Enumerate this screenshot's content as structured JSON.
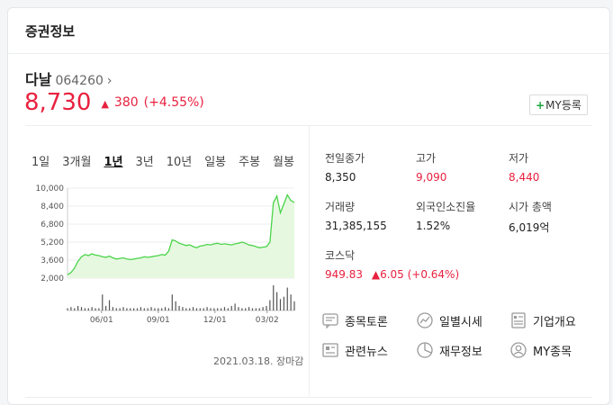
{
  "header": {
    "title": "증권정보"
  },
  "stock": {
    "name": "다날",
    "code": "064260",
    "price": "8,730",
    "change": "380",
    "change_pct": "(+4.55%)",
    "my_button": "MY등록"
  },
  "periods": [
    "1일",
    "3개월",
    "1년",
    "3년",
    "10년",
    "일봉",
    "주봉",
    "월봉"
  ],
  "active_period": "1년",
  "chart_data": {
    "type": "area",
    "y_ticks": [
      "10,000",
      "8,400",
      "6,800",
      "5,200",
      "3,600",
      "2,000"
    ],
    "x_ticks": [
      "06/01",
      "09/01",
      "12/01",
      "03/02"
    ],
    "ylim": [
      2000,
      10000
    ],
    "values": [
      2300,
      2500,
      2900,
      3500,
      3900,
      4100,
      4000,
      4150,
      4050,
      4000,
      3900,
      3850,
      3950,
      3800,
      3700,
      3750,
      3800,
      3700,
      3650,
      3700,
      3750,
      3800,
      3900,
      3850,
      3900,
      3950,
      4000,
      4100,
      4050,
      4400,
      5400,
      5300,
      5100,
      5000,
      4900,
      4950,
      4800,
      4700,
      4850,
      4900,
      5000,
      4950,
      5050,
      5100,
      5000,
      5050,
      5000,
      4950,
      5050,
      5100,
      5200,
      5100,
      4950,
      4900,
      4800,
      4700,
      4750,
      4800,
      5200,
      8700,
      9300,
      7800,
      8600,
      9400,
      8900,
      8730
    ],
    "volume": [
      2,
      3,
      2,
      4,
      3,
      2,
      2,
      3,
      2,
      2,
      14,
      4,
      9,
      3,
      2,
      2,
      3,
      2,
      2,
      2,
      2,
      3,
      2,
      2,
      3,
      2,
      2,
      2,
      3,
      2,
      14,
      8,
      4,
      3,
      2,
      2,
      3,
      2,
      2,
      2,
      3,
      2,
      2,
      2,
      2,
      3,
      2,
      4,
      6,
      3,
      2,
      2,
      3,
      2,
      2,
      2,
      3,
      4,
      9,
      22,
      16,
      10,
      12,
      20,
      14,
      8
    ]
  },
  "updated": "2021.03.18. 장마감",
  "stats": [
    {
      "label": "전일종가",
      "value": "8,350",
      "red": false
    },
    {
      "label": "고가",
      "value": "9,090",
      "red": true
    },
    {
      "label": "저가",
      "value": "8,440",
      "red": true
    },
    {
      "label": "거래량",
      "value": "31,385,155",
      "red": false
    },
    {
      "label": "외국인소진율",
      "value": "1.52%",
      "red": false
    },
    {
      "label": "시가 총액",
      "value": "6,019억",
      "red": false
    }
  ],
  "kosdaq": {
    "label": "코스닥",
    "value": "949.83",
    "change": "6.05 (+0.64%)"
  },
  "menu": [
    {
      "label": "종목토론",
      "icon": "discussion-icon"
    },
    {
      "label": "일별시세",
      "icon": "chart-line-icon"
    },
    {
      "label": "기업개요",
      "icon": "document-icon"
    },
    {
      "label": "관련뉴스",
      "icon": "news-icon"
    },
    {
      "label": "재무정보",
      "icon": "pie-chart-icon"
    },
    {
      "label": "MY종목",
      "icon": "user-icon"
    }
  ],
  "colors": {
    "up": "#e8213f",
    "accent": "#1aa33c",
    "chart_line": "#4bd44b",
    "chart_fill": "#e6f8e0"
  }
}
